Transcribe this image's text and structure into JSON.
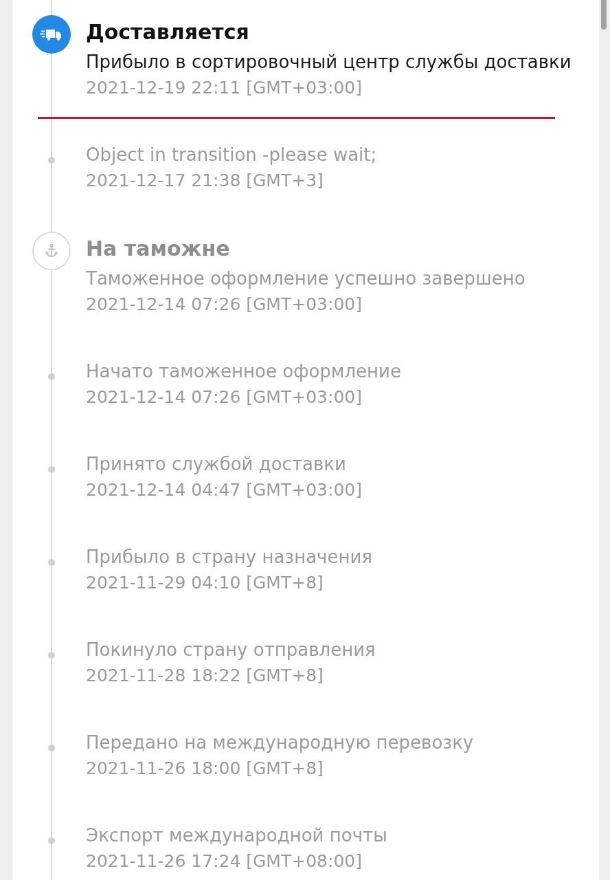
{
  "events": [
    {
      "kind": "delivering",
      "current": true,
      "title": "Доставляется",
      "description": "Прибыло в сортировочный центр службы доставки",
      "time": "2021-12-19 22:11 [GMT+03:00]"
    },
    {
      "kind": "event",
      "current": false,
      "description": "Object in transition -please wait;",
      "time": "2021-12-17 21:38 [GMT+3]"
    },
    {
      "kind": "customs",
      "current": false,
      "title": "На таможне",
      "description": "Таможенное оформление успешно завершено",
      "time": "2021-12-14 07:26 [GMT+03:00]"
    },
    {
      "kind": "event",
      "current": false,
      "description": "Начато таможенное оформление",
      "time": "2021-12-14 07:26 [GMT+03:00]"
    },
    {
      "kind": "event",
      "current": false,
      "description": "Принято службой доставки",
      "time": "2021-12-14 04:47 [GMT+03:00]"
    },
    {
      "kind": "event",
      "current": false,
      "description": "Прибыло в страну назначения",
      "time": "2021-11-29 04:10 [GMT+8]"
    },
    {
      "kind": "event",
      "current": false,
      "description": "Покинуло страну отправления",
      "time": "2021-11-28 18:22 [GMT+8]"
    },
    {
      "kind": "event",
      "current": false,
      "description": "Передано на международную перевозку",
      "time": "2021-11-26 18:00 [GMT+8]"
    },
    {
      "kind": "event",
      "current": false,
      "description": "Экспорт международной почты",
      "time": "2021-11-26 17:24 [GMT+08:00]"
    }
  ]
}
